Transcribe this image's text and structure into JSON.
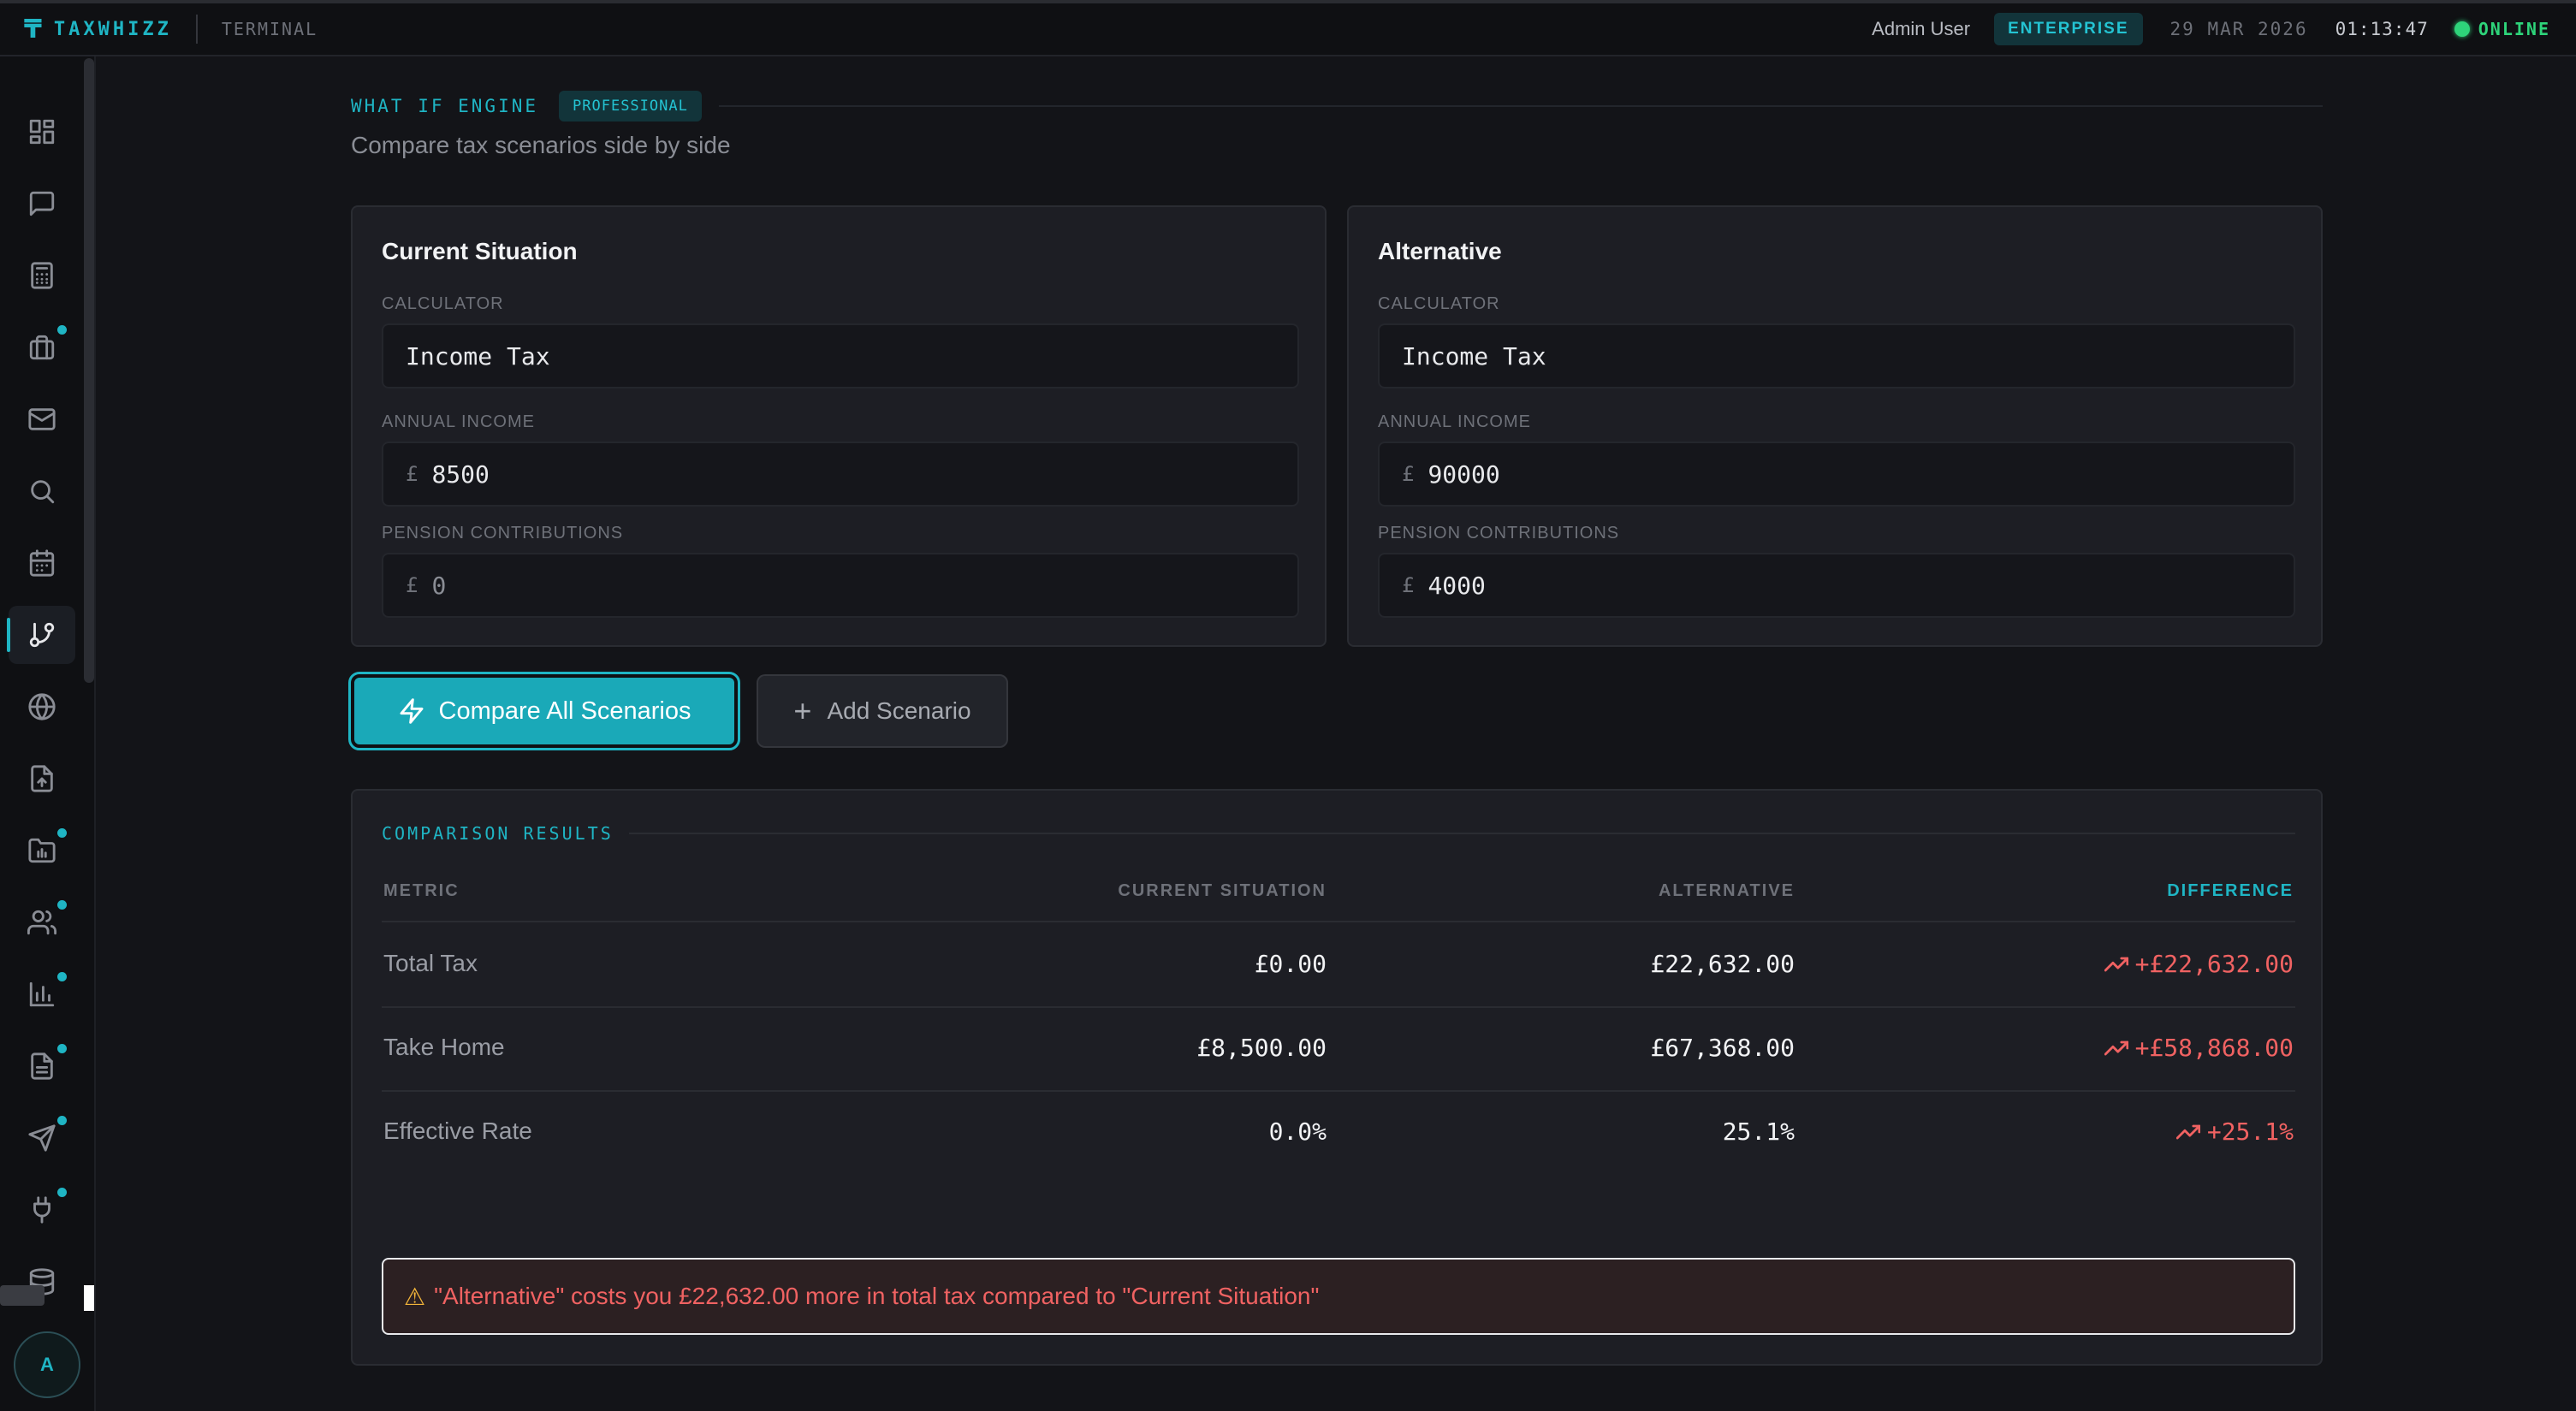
{
  "app": {
    "brand": "TAXWHIZZ",
    "sub": "TERMINAL",
    "user": "Admin User",
    "plan": "ENTERPRISE",
    "date": "29 MAR 2026",
    "time": "01:13:47",
    "status": "ONLINE",
    "avatar_initial": "A",
    "accent_color": "#1fb5c4",
    "online_color": "#2ed47a"
  },
  "sidebar": {
    "items": [
      {
        "icon": "dashboard-icon",
        "active": false,
        "dot": false
      },
      {
        "icon": "chat-icon",
        "active": false,
        "dot": false
      },
      {
        "icon": "calculator-icon",
        "active": false,
        "dot": false
      },
      {
        "icon": "briefcase-icon",
        "active": false,
        "dot": true
      },
      {
        "icon": "mail-icon",
        "active": false,
        "dot": false
      },
      {
        "icon": "search-icon",
        "active": false,
        "dot": false
      },
      {
        "icon": "calendar-icon",
        "active": false,
        "dot": false
      },
      {
        "icon": "git-branch-icon",
        "active": true,
        "dot": false
      },
      {
        "icon": "globe-icon",
        "active": false,
        "dot": false
      },
      {
        "icon": "file-upload-icon",
        "active": false,
        "dot": false
      },
      {
        "icon": "folder-icon",
        "active": false,
        "dot": true
      },
      {
        "icon": "users-icon",
        "active": false,
        "dot": true
      },
      {
        "icon": "bar-chart-icon",
        "active": false,
        "dot": true
      },
      {
        "icon": "document-icon",
        "active": false,
        "dot": true
      },
      {
        "icon": "send-icon",
        "active": false,
        "dot": true
      },
      {
        "icon": "plug-icon",
        "active": false,
        "dot": true
      },
      {
        "icon": "database-icon",
        "active": false,
        "dot": false
      }
    ]
  },
  "page": {
    "title": "WHAT IF ENGINE",
    "badge": "PROFESSIONAL",
    "subtitle": "Compare tax scenarios side by side"
  },
  "scenarios": [
    {
      "title": "Current Situation",
      "calculator_label": "CALCULATOR",
      "calculator": "Income Tax",
      "income_label": "ANNUAL INCOME",
      "currency": "£",
      "income": "8500",
      "pension_label": "PENSION CONTRIBUTIONS",
      "pension": "0"
    },
    {
      "title": "Alternative",
      "calculator_label": "CALCULATOR",
      "calculator": "Income Tax",
      "income_label": "ANNUAL INCOME",
      "currency": "£",
      "income": "90000",
      "pension_label": "PENSION CONTRIBUTIONS",
      "pension": "4000"
    }
  ],
  "actions": {
    "compare": "Compare All Scenarios",
    "add": "Add Scenario"
  },
  "results": {
    "title": "COMPARISON RESULTS",
    "columns": [
      "METRIC",
      "CURRENT SITUATION",
      "ALTERNATIVE",
      "DIFFERENCE"
    ],
    "rows": [
      {
        "metric": "Total Tax",
        "current": "£0.00",
        "alternative": "£22,632.00",
        "difference": "+£22,632.00"
      },
      {
        "metric": "Take Home",
        "current": "£8,500.00",
        "alternative": "£67,368.00",
        "difference": "+£58,868.00"
      },
      {
        "metric": "Effective Rate",
        "current": "0.0%",
        "alternative": "25.1%",
        "difference": "+25.1%"
      }
    ],
    "warning": "\"Alternative\" costs you £22,632.00 more in total tax compared to \"Current Situation\"",
    "warning_color": "#f06262"
  }
}
